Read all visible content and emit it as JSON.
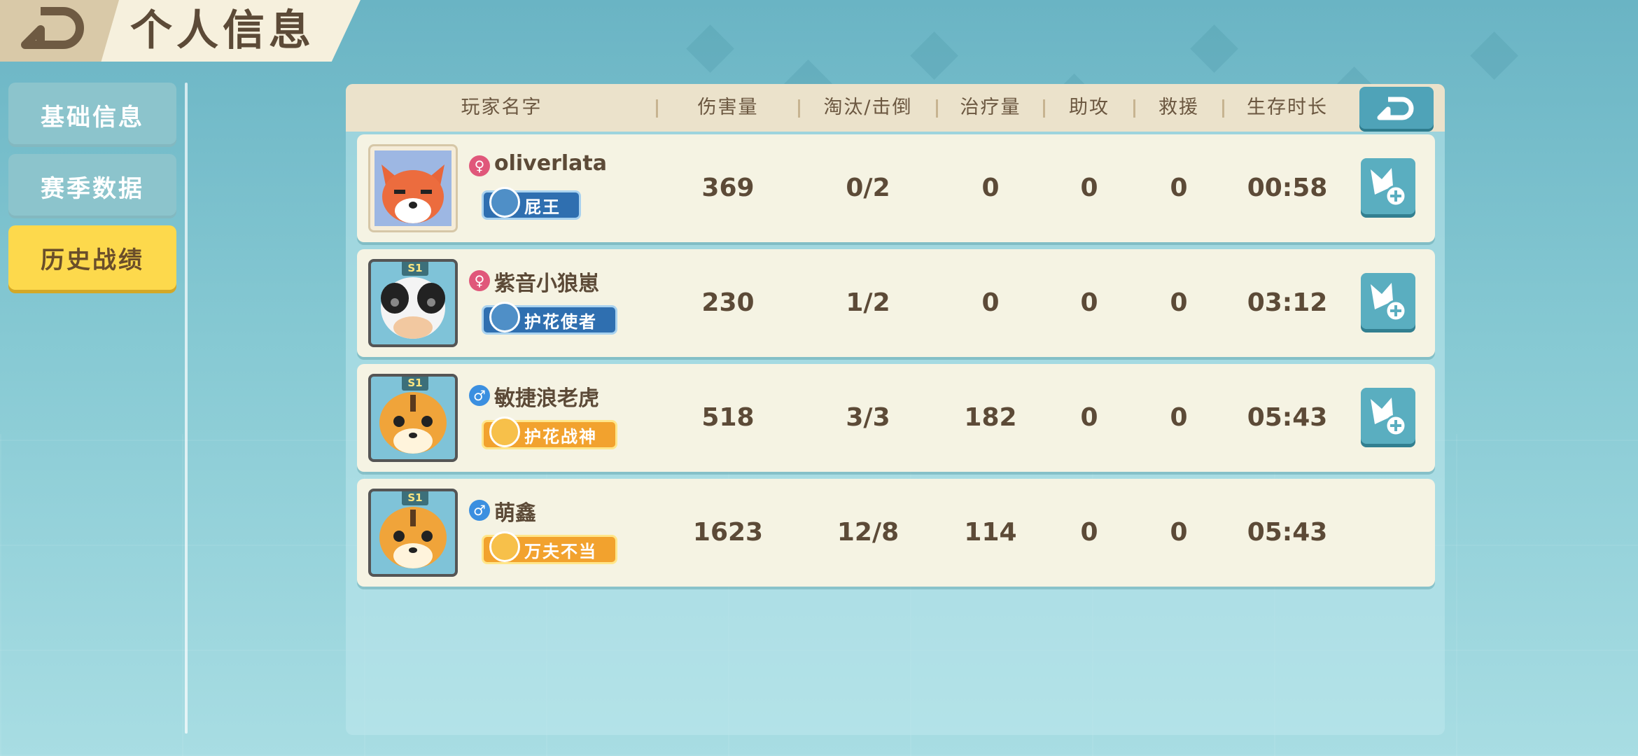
{
  "header": {
    "title": "个人信息"
  },
  "nav": {
    "items": [
      {
        "label": "基础信息",
        "active": false
      },
      {
        "label": "赛季数据",
        "active": false
      },
      {
        "label": "历史战绩",
        "active": true
      }
    ]
  },
  "table": {
    "columns": [
      "玩家名字",
      "伤害量",
      "淘汰/击倒",
      "治疗量",
      "助攻",
      "救援",
      "生存时长"
    ],
    "rows": [
      {
        "avatar": "fox-avatar",
        "frame": "",
        "gender": "female",
        "name": "oliverlata",
        "title": "屁王",
        "title_style": "blue",
        "damage": "369",
        "kd": "0/2",
        "heal": "0",
        "assist": "0",
        "rescue": "0",
        "survival": "00:58",
        "add_friend": true
      },
      {
        "avatar": "cow-avatar",
        "frame": "S1",
        "gender": "female",
        "name": "紫音小狼崽",
        "title": "护花使者",
        "title_style": "blue",
        "damage": "230",
        "kd": "1/2",
        "heal": "0",
        "assist": "0",
        "rescue": "0",
        "survival": "03:12",
        "add_friend": true
      },
      {
        "avatar": "tiger-avatar",
        "frame": "S1",
        "gender": "male",
        "name": "敏捷浪老虎",
        "title": "护花战神",
        "title_style": "gold",
        "damage": "518",
        "kd": "3/3",
        "heal": "182",
        "assist": "0",
        "rescue": "0",
        "survival": "05:43",
        "add_friend": true
      },
      {
        "avatar": "tiger-avatar",
        "frame": "S1",
        "gender": "male",
        "name": "萌鑫",
        "title": "万夫不当",
        "title_style": "gold",
        "damage": "1623",
        "kd": "12/8",
        "heal": "114",
        "assist": "0",
        "rescue": "0",
        "survival": "05:43",
        "add_friend": false
      }
    ]
  },
  "colors": {
    "accent": "#4fa3b8",
    "nav_active": "#fdd94c",
    "row_bg": "#f5f3e3",
    "female": "#e0577a",
    "male": "#3b8fe0"
  }
}
